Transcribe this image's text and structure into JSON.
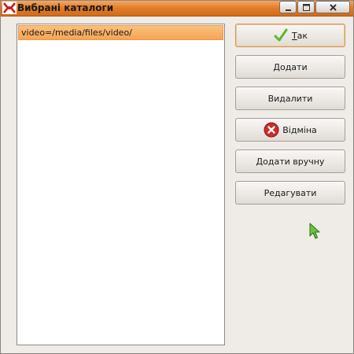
{
  "window": {
    "title": "Вибрані каталоги",
    "controls": {
      "minimize_icon": "minimize-icon",
      "maximize_icon": "maximize-icon",
      "close_icon": "close-icon"
    }
  },
  "directory_list": {
    "items": [
      {
        "label": "video=/media/files/video/",
        "selected": true
      }
    ]
  },
  "buttons": {
    "ok": {
      "label_mnemonic": "Т",
      "label_rest": "ак",
      "icon": "checkmark-icon"
    },
    "add": {
      "label": "Додати"
    },
    "remove": {
      "label": "Видалити"
    },
    "cancel": {
      "label": "Відміна",
      "icon": "cancel-icon"
    },
    "add_manually": {
      "label": "Додати вручну"
    },
    "edit": {
      "label": "Редагувати"
    }
  },
  "colors": {
    "titlebar": "#e27f2c",
    "selection": "#f5a553",
    "window_bg": "#efebe7",
    "cancel_icon": "#d12a2a",
    "checkmark": "#5db82e",
    "cursor": "#6cc43a"
  }
}
